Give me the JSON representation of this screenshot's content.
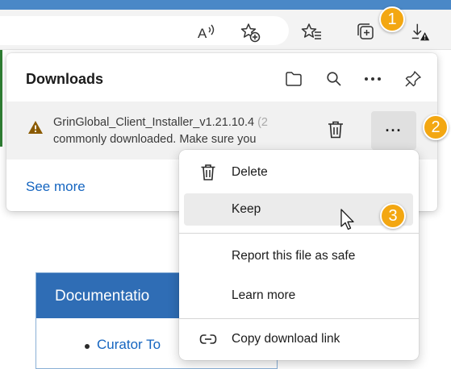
{
  "browser": {
    "read_aloud_icon": "read-aloud-icon",
    "add_favorite_icon": "add-favorite-icon",
    "favorites_icon": "favorites-icon",
    "collections_icon": "collections-icon",
    "downloads_icon": "downloads-warning-icon"
  },
  "callouts": {
    "one": "1",
    "two": "2",
    "three": "3"
  },
  "downloads_panel": {
    "title": "Downloads",
    "item": {
      "line1": "GrinGlobal_Client_Installer_v1.21.10.4",
      "line1_faded": " (2",
      "line2": "commonly downloaded. Make sure you",
      "status_icon": "warning-icon",
      "more_label": "···"
    },
    "see_more": "See more"
  },
  "context_menu": {
    "items": [
      {
        "label": "Delete",
        "icon": "trash-icon"
      },
      {
        "label": "Keep"
      },
      {
        "label": "Report this file as safe"
      },
      {
        "label": "Learn more"
      },
      {
        "label": "Copy download link",
        "icon": "link-icon"
      }
    ]
  },
  "page": {
    "doc_header": "Documentatio",
    "doc_link": "Curator To"
  },
  "colors": {
    "accent_blue": "#2f6db5",
    "callout_orange": "#f3a712",
    "link_blue": "#1565c0",
    "warning_brown": "#8a5a00"
  }
}
